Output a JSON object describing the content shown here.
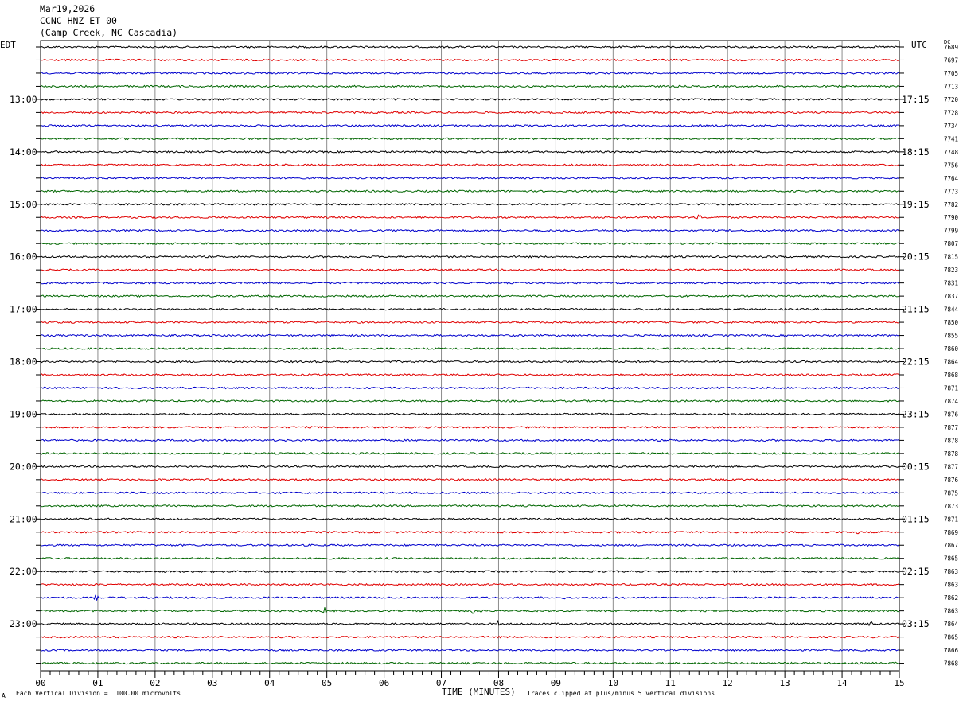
{
  "header": {
    "date": "Mar19,2026",
    "channel": "CCNC HNZ ET 00",
    "location": "(Camp Creek, NC Cascadia)"
  },
  "left_timezone": "EDT",
  "right_timezone": "UTC",
  "dc_label": "DC",
  "footer": {
    "left_text": "Each Vertical Division =  100.00 microvolts",
    "center_text": "TIME (MINUTES)",
    "right_text": "Traces clipped at plus/minus 5 vertical divisions",
    "mark": "A"
  },
  "colors": {
    "trace_cycle": [
      "#000000",
      "#e00000",
      "#0000cc",
      "#006600"
    ],
    "grid": "#8c8c8c",
    "axis": "#000000"
  },
  "chart_data": {
    "type": "line",
    "title": "",
    "xlabel": "TIME (MINUTES)",
    "xlim": [
      0,
      15
    ],
    "x_ticks": [
      "00",
      "01",
      "02",
      "03",
      "04",
      "05",
      "06",
      "07",
      "08",
      "09",
      "10",
      "11",
      "12",
      "13",
      "14",
      "15"
    ],
    "trace_count": 48,
    "trace_span_minutes": 15,
    "left_hour_labels": [
      "13:00",
      "14:00",
      "15:00",
      "16:00",
      "17:00",
      "18:00",
      "19:00",
      "20:00",
      "21:00",
      "22:00",
      "23:00"
    ],
    "right_hour_labels": [
      "17:15",
      "18:15",
      "19:15",
      "20:15",
      "21:15",
      "22:15",
      "23:15",
      "00:15",
      "01:15",
      "02:15",
      "03:15"
    ],
    "dc_offsets": [
      "7689",
      "7697",
      "7705",
      "7713",
      "7720",
      "7728",
      "7734",
      "7741",
      "7748",
      "7756",
      "7764",
      "7773",
      "7782",
      "7790",
      "7799",
      "7807",
      "7815",
      "7823",
      "7831",
      "7837",
      "7844",
      "7850",
      "7855",
      "7860",
      "7864",
      "7868",
      "7871",
      "7874",
      "7876",
      "7877",
      "7878",
      "7878",
      "7877",
      "7876",
      "7875",
      "7873",
      "7871",
      "7869",
      "7867",
      "7865",
      "7863",
      "7863",
      "7862",
      "7863",
      "7864",
      "7865",
      "7866",
      "7868"
    ],
    "events": [
      {
        "trace": 13,
        "minute": 11.5,
        "amplitude": 8
      },
      {
        "trace": 13,
        "minute": 11.3,
        "amplitude": 4
      },
      {
        "trace": 37,
        "minute": 14.25,
        "amplitude": 6
      },
      {
        "trace": 42,
        "minute": 0.97,
        "amplitude": 4
      },
      {
        "trace": 42,
        "minute": 8.7,
        "amplitude": 3
      },
      {
        "trace": 42,
        "minute": 9.15,
        "amplitude": 3
      },
      {
        "trace": 43,
        "minute": 4.95,
        "amplitude": 9
      },
      {
        "trace": 43,
        "minute": 7.55,
        "amplitude": 5
      },
      {
        "trace": 43,
        "minute": 7.7,
        "amplitude": 4
      },
      {
        "trace": 44,
        "minute": 8.0,
        "amplitude": 5
      },
      {
        "trace": 44,
        "minute": 14.5,
        "amplitude": 5
      },
      {
        "trace": 46,
        "minute": 13.65,
        "amplitude": 4
      },
      {
        "trace": 47,
        "minute": 14.95,
        "amplitude": 4
      },
      {
        "trace": 5,
        "minute": 1.6,
        "amplitude": 2
      },
      {
        "trace": 2,
        "minute": 3.6,
        "amplitude": 2
      },
      {
        "trace": 24,
        "minute": 6.65,
        "amplitude": 2
      }
    ]
  }
}
